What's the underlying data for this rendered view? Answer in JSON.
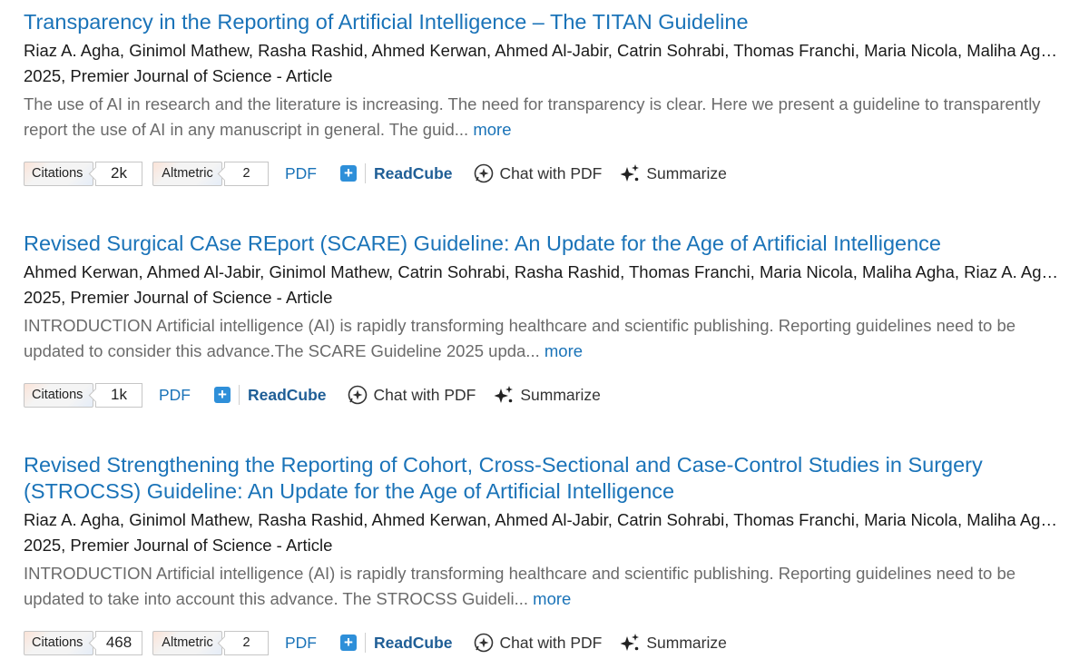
{
  "results": [
    {
      "title": "Transparency in the Reporting of Artificial Intelligence – The TITAN Guideline",
      "authors": "Riaz A. Agha, Ginimol Mathew, Rasha Rashid, Ahmed Kerwan, Ahmed Al-Jabir, Catrin Sohrabi, Thomas Franchi, Maria Nicola, Maliha Agha",
      "venue": "2025, Premier Journal of Science - Article",
      "abstract": "The use of AI in research and the literature is increasing. The need for transparency is clear. Here we present a guideline to transparently report the use of AI in any manuscript in general. The guid...",
      "more": "more",
      "citations_label": "Citations",
      "citations": "2k",
      "altmetric_label": "Altmetric",
      "altmetric": "2",
      "pdf": "PDF",
      "readcube": "ReadCube",
      "chat": "Chat with PDF",
      "summarize": "Summarize"
    },
    {
      "title": "Revised Surgical CAse REport (SCARE) Guideline: An Update for the Age of Artificial Intelligence",
      "authors": "Ahmed Kerwan, Ahmed Al-Jabir, Ginimol Mathew, Catrin Sohrabi, Rasha Rashid, Thomas Franchi, Maria Nicola, Maliha Agha, Riaz A. Agha",
      "venue": "2025, Premier Journal of Science - Article",
      "abstract": "INTRODUCTION Artificial intelligence (AI) is rapidly transforming healthcare and scientific publishing. Reporting guidelines need to be updated to consider this advance.The SCARE Guideline 2025 upda...",
      "more": "more",
      "citations_label": "Citations",
      "citations": "1k",
      "pdf": "PDF",
      "readcube": "ReadCube",
      "chat": "Chat with PDF",
      "summarize": "Summarize"
    },
    {
      "title": "Revised Strengthening the Reporting of Cohort, Cross-Sectional and Case-Control Studies in Surgery (STROCSS) Guideline: An Update for the Age of Artificial Intelligence",
      "authors": "Riaz A. Agha, Ginimol Mathew, Rasha Rashid, Ahmed Kerwan, Ahmed Al-Jabir, Catrin Sohrabi, Thomas Franchi, Maria Nicola, Maliha Agha",
      "venue": "2025, Premier Journal of Science - Article",
      "abstract": "INTRODUCTION Artificial intelligence (AI) is rapidly transforming healthcare and scientific publishing. Reporting guidelines need to be updated to take into account this advance. The STROCSS Guideli...",
      "more": "more",
      "citations_label": "Citations",
      "citations": "468",
      "altmetric_label": "Altmetric",
      "altmetric": "2",
      "pdf": "PDF",
      "readcube": "ReadCube",
      "chat": "Chat with PDF",
      "summarize": "Summarize"
    }
  ],
  "colors": {
    "link": "#1a73b8",
    "readcube_plus": "#2e8fd9",
    "readcube_text": "#1f5e96",
    "abstract": "#6b6b6b"
  },
  "icons": {
    "readcube": "plus-square-icon",
    "chat": "chat-pdf-icon",
    "summarize": "sparkle-icon"
  }
}
